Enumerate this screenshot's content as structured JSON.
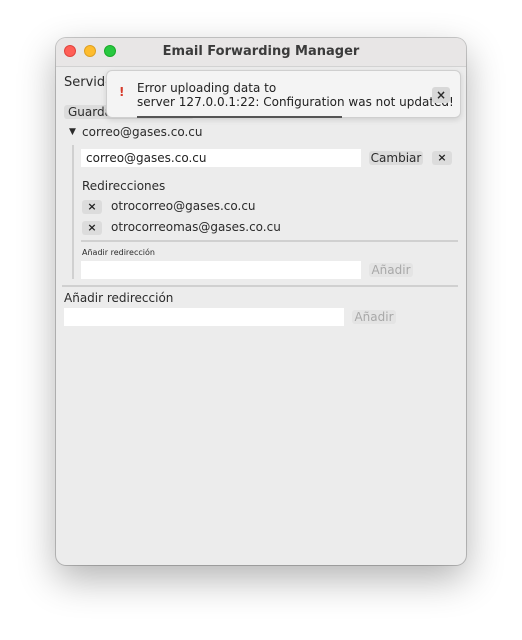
{
  "window": {
    "title": "Email Forwarding Manager"
  },
  "top": {
    "server_label": "Servido",
    "save_label": "Guarda"
  },
  "account": {
    "expand_icon": "triangle-down-icon",
    "email": "correo@gases.co.cu",
    "email_field_value": "correo@gases.co.cu",
    "change_label": "Cambiar",
    "delete_symbol": "×",
    "redirections_heading": "Redirecciones",
    "redirections": [
      {
        "remove_symbol": "×",
        "address": "otrocorreo@gases.co.cu"
      },
      {
        "remove_symbol": "×",
        "address": "otrocorreomas@gases.co.cu"
      }
    ],
    "add_redirection_label": "Añadir redirección",
    "add_redirection_value": "",
    "add_button_label": "Añadir"
  },
  "global_add": {
    "label": "Añadir redirección",
    "value": "",
    "button_label": "Añadir"
  },
  "notification": {
    "icon_symbol": "!",
    "message_line1": "Error uploading data to",
    "message_line2": "server 127.0.0.1:22: Configuration was not updated!",
    "close_symbol": "×",
    "progress": 0.58,
    "colors": {
      "icon": "#d63a2a"
    }
  }
}
